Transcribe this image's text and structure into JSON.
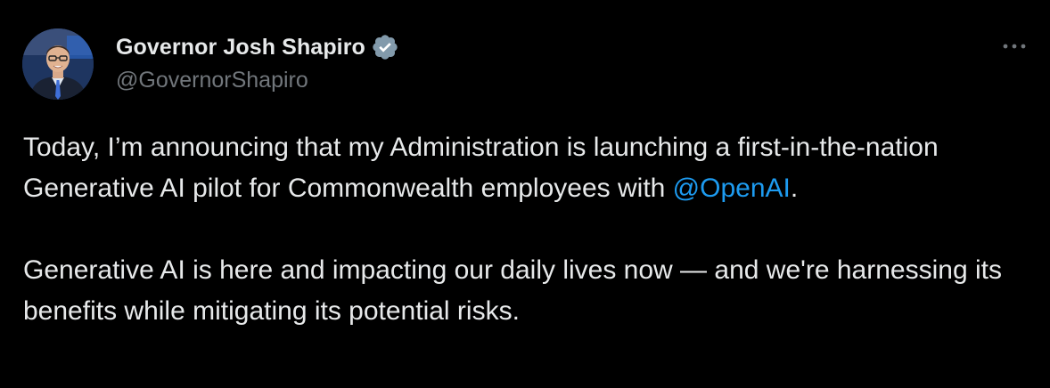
{
  "author": {
    "display_name": "Governor Josh Shapiro",
    "handle": "@GovernorShapiro",
    "verified_icon": "verified-badge-icon",
    "avatar_icon": "avatar-photo"
  },
  "menu": {
    "icon": "more-options-icon"
  },
  "tweet": {
    "para1_part1": "Today, I’m announcing that my Administration is launching a first-in-the-nation Generative AI pilot for Commonwealth employees with ",
    "para1_mention": "@OpenAI",
    "para1_part2": ".",
    "para2": "Generative AI is here and impacting our daily lives now — and we're harnessing its benefits while mitigating its potential risks."
  },
  "colors": {
    "background": "#000000",
    "text": "#e7e9ea",
    "secondary": "#71767b",
    "link": "#1d9bf0",
    "verified": "#829aab"
  }
}
